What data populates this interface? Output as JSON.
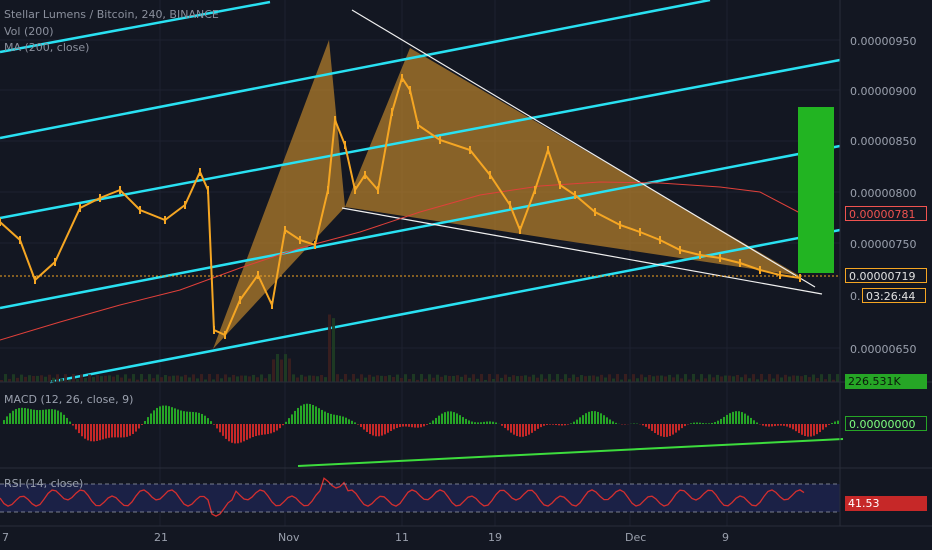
{
  "header": {
    "title": "Stellar Lumens / Bitcoin, 240, BINANCE",
    "vol_label": "Vol (200)",
    "ma_label": "MA (200, close)"
  },
  "price_axis": {
    "ticks": [
      "0.00000950",
      "0.00000900",
      "0.00000850",
      "0.00000800",
      "0.00000750",
      "0.00000650"
    ],
    "ma_tag": "0.00000781",
    "price_tag": "0.00000719",
    "countdown": "03:26:44",
    "partial_tick": "0.",
    "volume_tag": "226.531K"
  },
  "x_axis": {
    "labels": [
      "7",
      "21",
      "Nov",
      "11",
      "19",
      "Dec",
      "9"
    ]
  },
  "macd": {
    "label": "MACD (12, 26, close, 9)",
    "tag": "0.00000000"
  },
  "rsi": {
    "label": "RSI (14, close)",
    "tag": "41.53"
  },
  "colors": {
    "background": "#131722",
    "cyan": "#29e1f2",
    "candle": "#f5a623",
    "pattern_fill": "#c88a2c",
    "ma": "#e0403a",
    "green": "#22b422",
    "macd_pos": "#26a626",
    "macd_neg": "#c62828",
    "rsi_line": "#d32f2f",
    "rsi_band": "#1b2146"
  },
  "chart_data": {
    "type": "line",
    "title": "Stellar Lumens / Bitcoin, 240, BINANCE",
    "xlabel": "",
    "ylabel": "",
    "x": [
      "7",
      "21",
      "Nov",
      "11",
      "19",
      "Dec",
      "9"
    ],
    "ylim": [
      6.2e-06,
      9.85e-06
    ],
    "series": [
      {
        "name": "Stellar Lumens / Bitcoin",
        "values": [
          7.7e-06,
          7.6e-06,
          7.2e-06,
          8e-06,
          7.95e-06,
          8.1e-06,
          6.5e-06,
          7e-06,
          7.2e-06,
          7.6e-06,
          9.4e-06,
          8e-06,
          8.5e-06,
          9.3e-06,
          8.7e-06,
          8.4e-06,
          7.8e-06,
          8.4e-06,
          7.9e-06,
          7.6e-06,
          7.4e-06,
          7.29e-06,
          7.19e-06
        ]
      },
      {
        "name": "MA (200, close)",
        "values": [
          6.6e-06,
          6.8e-06,
          7e-06,
          7.15e-06,
          7.3e-06,
          7.5e-06,
          7.7e-06,
          7.85e-06,
          7.95e-06,
          8e-06,
          7.95e-06,
          7.9e-06,
          7.81e-06
        ]
      }
    ],
    "price_current": 7.19e-06,
    "ma_current": 7.81e-06,
    "volume_current": "226.531K",
    "macd_current": 0.0,
    "rsi_current": 41.53
  }
}
